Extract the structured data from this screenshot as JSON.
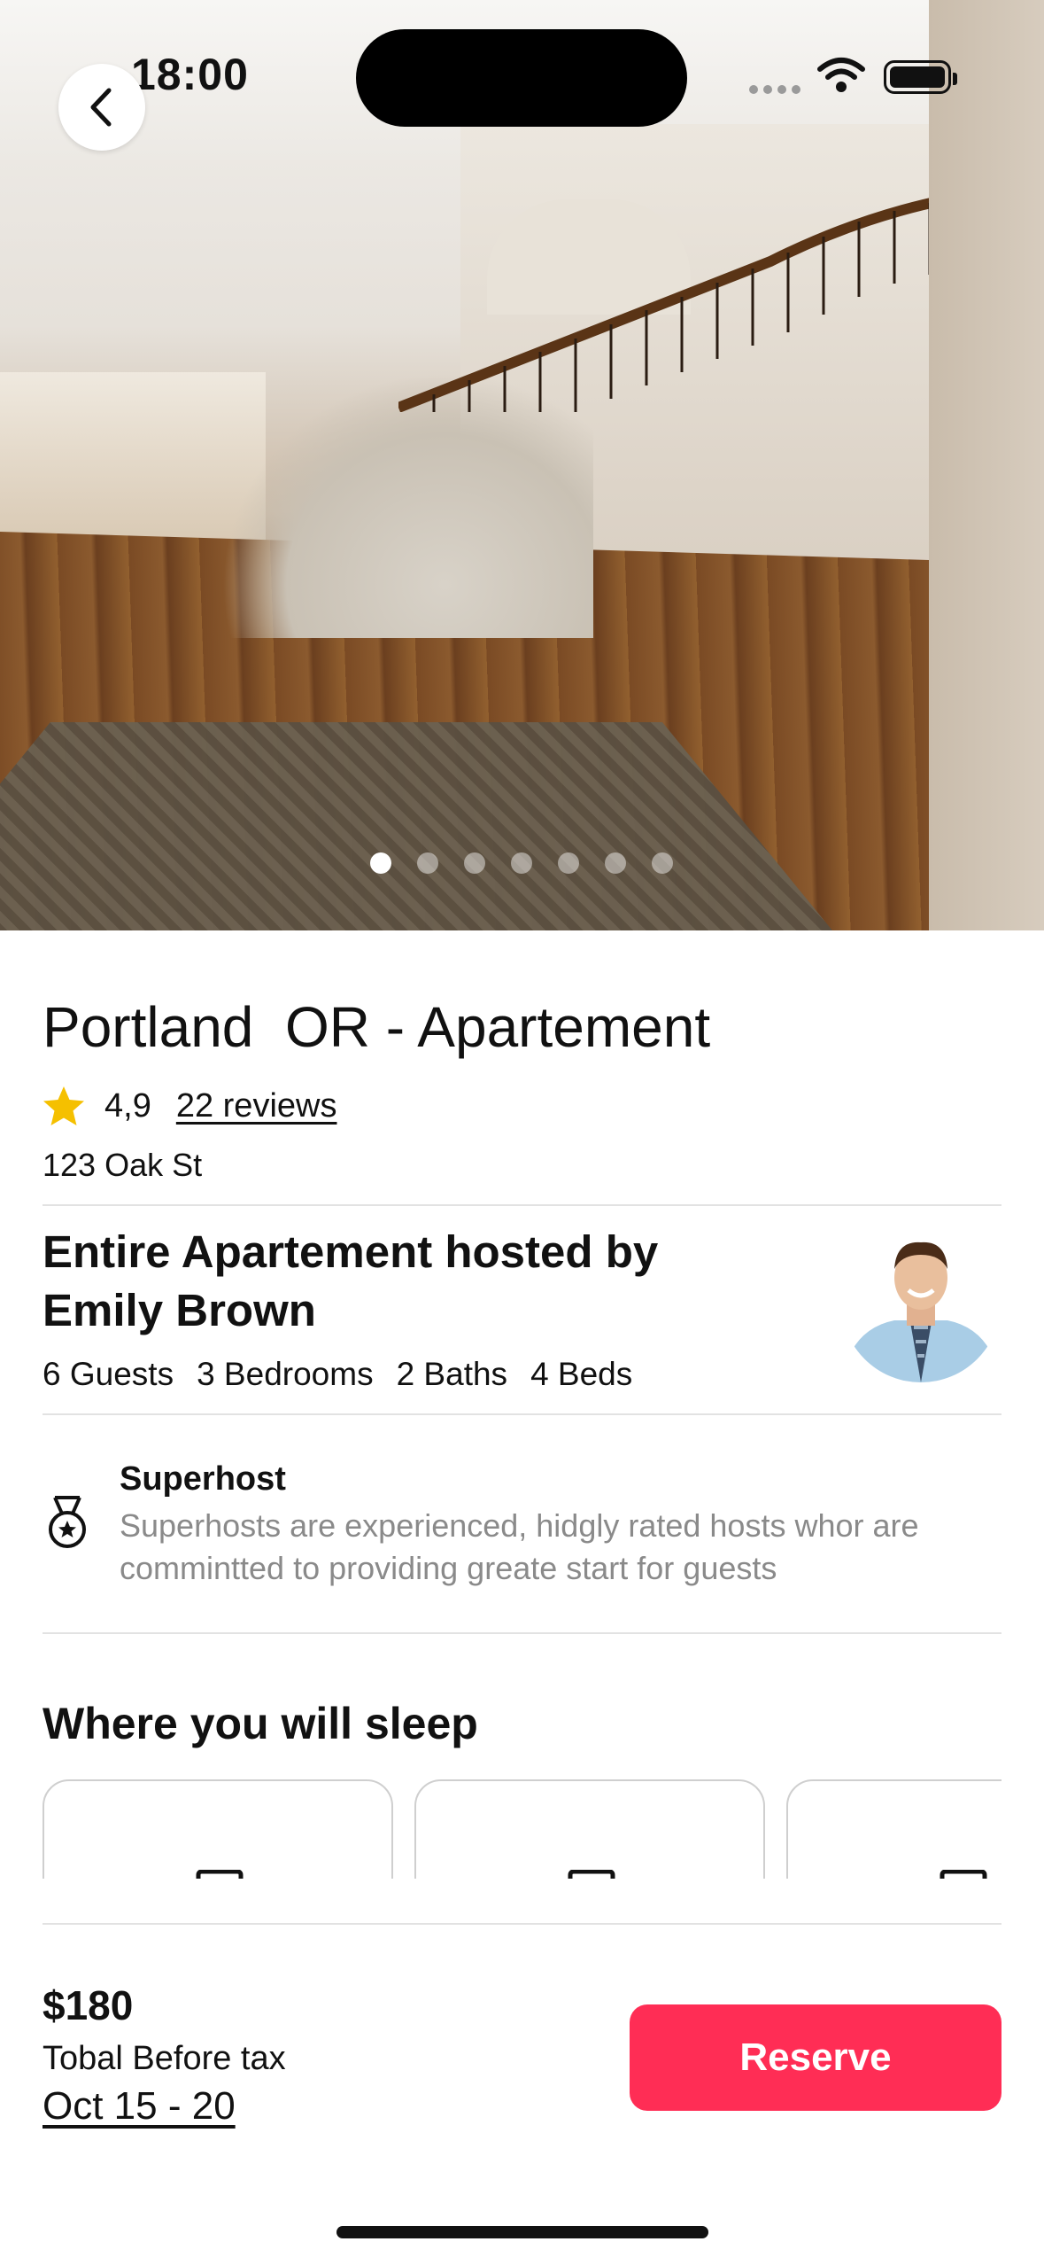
{
  "status_bar": {
    "time": "18:00"
  },
  "gallery": {
    "photo_count": 7,
    "active_index": 0
  },
  "listing": {
    "title": "Portland  OR - Apartement",
    "rating": "4,9",
    "reviews": "22 reviews",
    "address": "123 Oak St"
  },
  "host": {
    "title": "Entire Apartement hosted by Emily Brown",
    "specs": [
      "6 Guests",
      "3  Bedrooms",
      "2  Baths",
      "4  Beds"
    ]
  },
  "superhost": {
    "title": "Superhost",
    "description": "Superhosts are experienced, hidgly rated hosts whor are commintted to providing greate start for guests"
  },
  "sleep": {
    "title": "Where you will sleep"
  },
  "booking": {
    "price": "$180",
    "price_note": "Tobal Before tax",
    "dates": "Oct 15 - 20",
    "reserve_label": "Reserve"
  },
  "colors": {
    "accent": "#ff2d55",
    "star": "#f5c000",
    "muted_text": "#8a8a8a"
  },
  "icons": [
    "back-chevron-icon",
    "wifi-icon",
    "battery-icon",
    "star-icon",
    "medal-icon",
    "bed-icon"
  ]
}
